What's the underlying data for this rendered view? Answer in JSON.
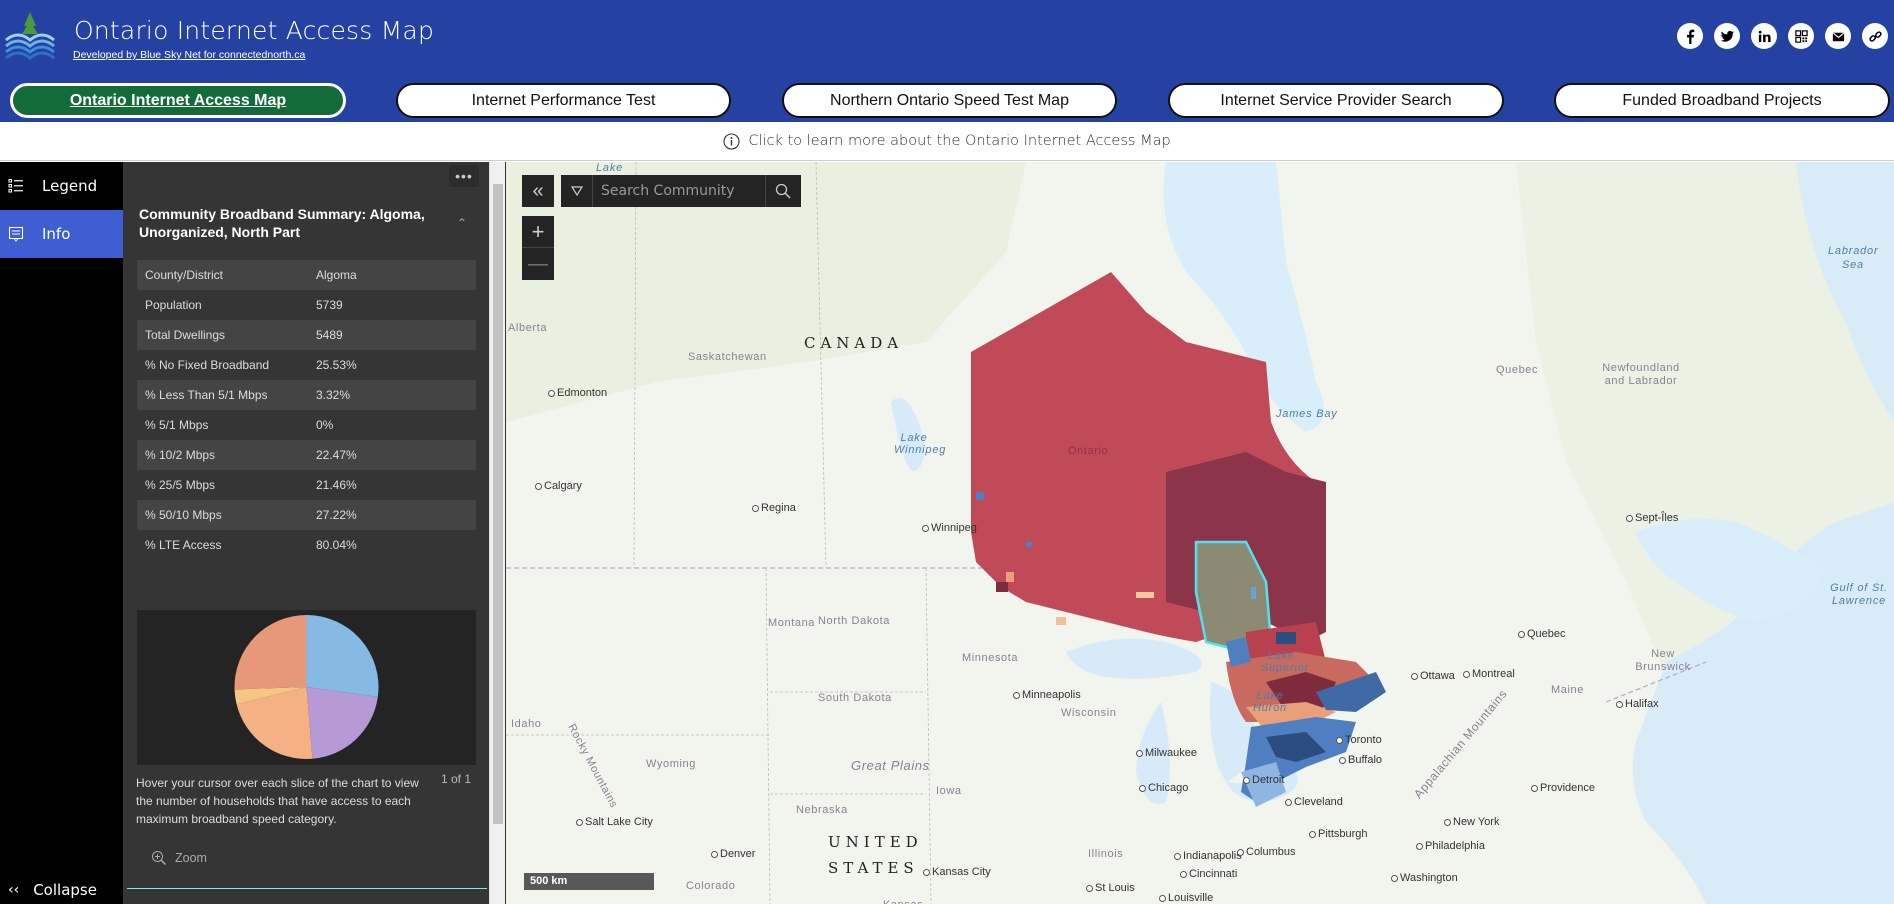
{
  "header": {
    "title": "Ontario Internet Access Map",
    "subtitle": "Developed by Blue Sky Net for connectednorth.ca",
    "social": [
      "facebook",
      "twitter",
      "linkedin",
      "qr-code",
      "email",
      "link"
    ]
  },
  "nav": {
    "buttons": [
      {
        "label": "Ontario Internet Access Map",
        "active": true
      },
      {
        "label": "Internet Performance Test",
        "active": false
      },
      {
        "label": "Northern Ontario Speed Test Map",
        "active": false
      },
      {
        "label": "Internet Service Provider Search",
        "active": false
      },
      {
        "label": "Funded Broadband Projects",
        "active": false
      }
    ]
  },
  "infobar": {
    "text": "Click to learn more about the Ontario Internet Access Map"
  },
  "sidebar": {
    "items": [
      {
        "label": "Legend",
        "icon": "legend-icon"
      },
      {
        "label": "Info",
        "icon": "info-icon"
      }
    ],
    "collapse_label": "Collapse"
  },
  "panel": {
    "title": "Community Broadband Summary: Algoma, Unorganized, North Part",
    "rows": [
      {
        "key": "County/District",
        "value": "Algoma"
      },
      {
        "key": "Population",
        "value": "5739"
      },
      {
        "key": "Total Dwellings",
        "value": "5489"
      },
      {
        "key": "% No Fixed Broadband",
        "value": "25.53%"
      },
      {
        "key": "% Less Than 5/1 Mbps",
        "value": "3.32%"
      },
      {
        "key": "% 5/1 Mbps",
        "value": "0%"
      },
      {
        "key": "% 10/2 Mbps",
        "value": "22.47%"
      },
      {
        "key": "% 25/5 Mbps",
        "value": "21.46%"
      },
      {
        "key": "% 50/10 Mbps",
        "value": "27.22%"
      },
      {
        "key": "% LTE Access",
        "value": "80.04%"
      }
    ],
    "hover_text": "Hover your cursor over each slice of the chart to view the number of households that have access to each maximum broadband speed category.",
    "page_count": "1 of 1",
    "zoom_label": "Zoom"
  },
  "chart_data": {
    "type": "pie",
    "title": "",
    "slices": [
      {
        "name": "50/10 Mbps",
        "value": 27.22,
        "color": "#85bae4"
      },
      {
        "name": "25/5 Mbps",
        "value": 21.46,
        "color": "#b59ad6"
      },
      {
        "name": "10/2 Mbps",
        "value": 22.47,
        "color": "#f3b184"
      },
      {
        "name": "5/1 Mbps",
        "value": 0,
        "color": "#f7d98f"
      },
      {
        "name": "Less Than 5/1 Mbps",
        "value": 3.32,
        "color": "#f5c785"
      },
      {
        "name": "No Fixed Broadband",
        "value": 25.53,
        "color": "#e8987a"
      }
    ]
  },
  "map": {
    "search_placeholder": "Search Community",
    "scale_label": "500 km",
    "labels": {
      "countries": [
        "CANADA",
        "UNITED",
        "STATES"
      ],
      "states": [
        "Alberta",
        "Saskatchewan",
        "Ontario",
        "Quebec",
        "Newfoundland and Labrador",
        "Montana",
        "North Dakota",
        "South Dakota",
        "Minnesota",
        "Wisconsin",
        "Idaho",
        "Wyoming",
        "Nebraska",
        "Iowa",
        "Illinois",
        "Colorado",
        "Maine",
        "New Brunswick",
        "Kansas"
      ],
      "water": [
        "Lake",
        "Lake Winnipeg",
        "James Bay",
        "Labrador Sea",
        "Gulf of St. Lawrence",
        "Lake Superior",
        "Lake Huron"
      ],
      "features": [
        "Rocky Mountains",
        "Great Plains",
        "Appalachian Mountains"
      ],
      "cities": [
        "Edmonton",
        "Calgary",
        "Regina",
        "Winnipeg",
        "Minneapolis",
        "Milwaukee",
        "Chicago",
        "Salt Lake City",
        "Denver",
        "Kansas City",
        "St Louis",
        "Indianapolis",
        "Columbus",
        "Cincinnati",
        "Louisville",
        "Pittsburgh",
        "Cleveland",
        "Detroit",
        "Toronto",
        "Buffalo",
        "Ottawa",
        "Montreal",
        "Quebec",
        "Sept-Îles",
        "Halifax",
        "Providence",
        "New York",
        "Philadelphia",
        "Washington"
      ]
    }
  },
  "colors": {
    "header": "#2541a1",
    "active_nav": "#146b3a",
    "sidebar_active": "#3e5ed1",
    "highlight": "#4fe3f0"
  }
}
